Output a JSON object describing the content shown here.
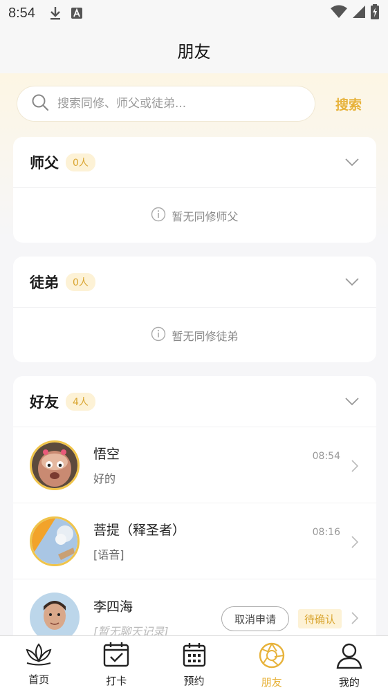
{
  "status_bar": {
    "time": "8:54",
    "icons": [
      "download-icon",
      "a-box-icon",
      "wifi-icon",
      "signal-icon",
      "battery-charging-icon"
    ]
  },
  "header": {
    "title": "朋友"
  },
  "search": {
    "placeholder": "搜索同修、师父或徒弟...",
    "button_label": "搜索"
  },
  "sections": {
    "master": {
      "title": "师父",
      "count": "0人",
      "empty_text": "暂无同修师父"
    },
    "disciple": {
      "title": "徒弟",
      "count": "0人",
      "empty_text": "暂无同修徒弟"
    },
    "friends": {
      "title": "好友",
      "count": "4人"
    }
  },
  "friends": [
    {
      "name": "悟空",
      "last_message": "好的",
      "time": "08:54",
      "avatar": "monkey-king-avatar"
    },
    {
      "name": "菩提（释圣者）",
      "last_message": "[语音]",
      "time": "08:16",
      "avatar": "sky-avatar"
    },
    {
      "name": "李四海",
      "last_message": "[暂无聊天记录]",
      "cancel_label": "取消申请",
      "status": "待确认",
      "avatar": "man-avatar"
    }
  ],
  "tabs": [
    {
      "label": "首页",
      "icon": "lotus-icon"
    },
    {
      "label": "打卡",
      "icon": "calendar-check-icon"
    },
    {
      "label": "预约",
      "icon": "calendar-grid-icon"
    },
    {
      "label": "朋友",
      "icon": "aperture-icon",
      "active": true
    },
    {
      "label": "我的",
      "icon": "person-icon"
    }
  ],
  "colors": {
    "accent": "#e7b23a",
    "badge_bg": "#fdf2d6",
    "badge_text": "#d9a530"
  }
}
